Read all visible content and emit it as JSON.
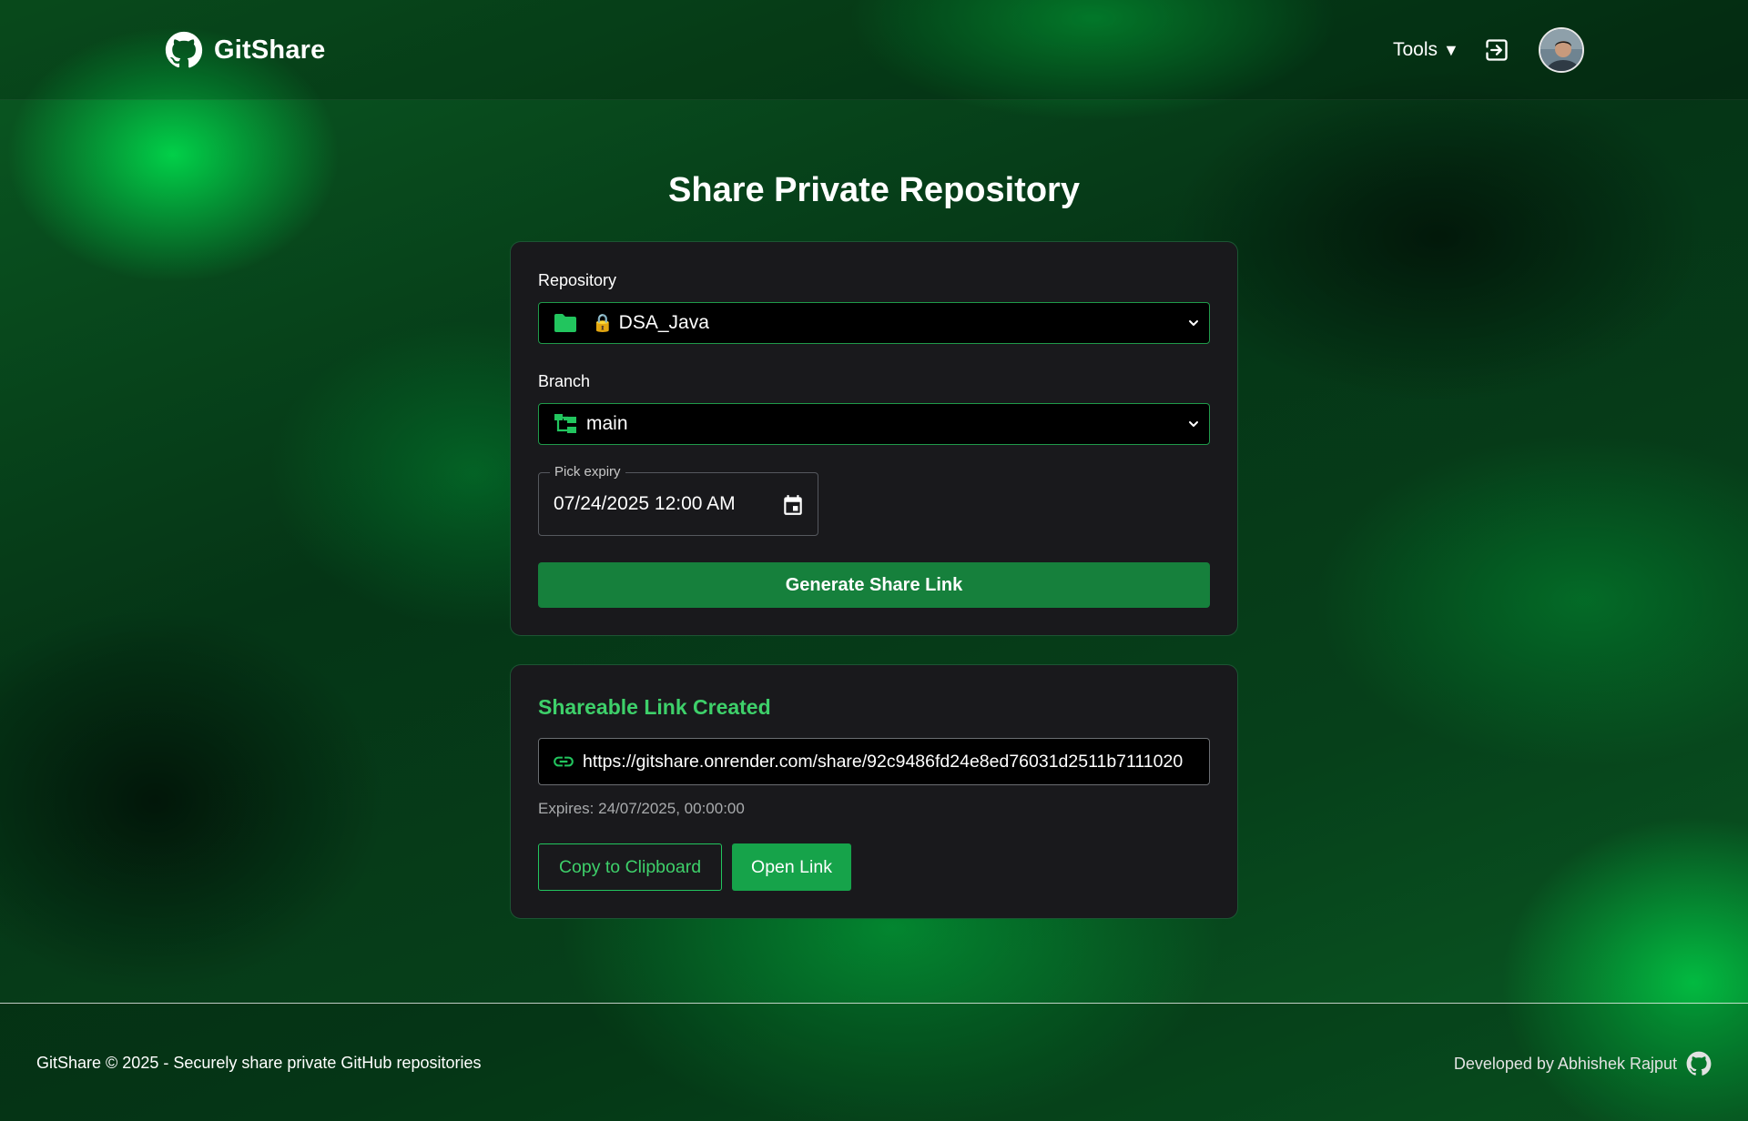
{
  "header": {
    "brand_name": "GitShare",
    "tools_label": "Tools",
    "tools_caret": "▼",
    "icons": [
      "github-logo-icon",
      "logout-icon",
      "avatar"
    ]
  },
  "main": {
    "title": "Share Private Repository",
    "form": {
      "repository_label": "Repository",
      "repository_lock": "🔒",
      "repository_value": "DSA_Java",
      "branch_label": "Branch",
      "branch_value": "main",
      "expiry_label": "Pick expiry",
      "expiry_value": "07/24/2025 12:00 AM",
      "generate_button": "Generate Share Link"
    },
    "result": {
      "title": "Shareable Link Created",
      "link": "https://gitshare.onrender.com/share/92c9486fd24e8ed76031d2511b7111020",
      "expires_text": "Expires: 24/07/2025, 00:00:00",
      "copy_button": "Copy to Clipboard",
      "open_button": "Open Link"
    }
  },
  "footer": {
    "left_text": "GitShare © 2025 - Securely share private GitHub repositories",
    "right_text": "Developed by Abhishek Rajput"
  },
  "colors": {
    "accent": "#22c55e",
    "button_green": "#16803c",
    "card_bg": "#19191c"
  }
}
